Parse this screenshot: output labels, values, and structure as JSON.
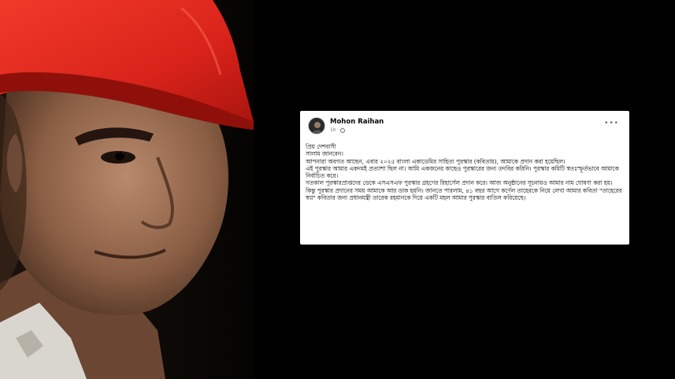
{
  "post": {
    "author": "Mohon Raihan",
    "time": "1h ·",
    "more": "•••",
    "lines": [
      "প্রিয় দেশবাসী",
      "সালাম জানবেন।",
      "আপনারা অবগত আছেন, এবার ২০২৫ বাংলা একাডেমির সাহিত্য পুরস্কার (কবিতায়), আমাকে প্রদান করা হয়েছিল।",
      "এই পুরস্কার আমার একদমই প্রত্যাশা ছিল না। আমি একজনের কাছেও পুরস্কারের জন্য তদবির করিনি। পুরস্কার কমিটি স্বতঃস্ফূর্তভাবে আমাকে নির্বাচিত করে।",
      "গতকাল পুরস্কারপ্রাপ্তদের ডেকে এসএসএফ পুরস্কার গ্রহণের রিহার্সেল প্রদান করে। আজ অনুষ্ঠানের সূচনায়ও আমার নাম ঘোষণা করা হয়।",
      "কিন্তু পুরস্কার প্রদানের সময় আমাকে আর ডাক হয়নি। জানতে পারলাম, ৪১ বছর আগে কর্ণেল তাহেরকে নিয়ে লেখা আমার কবিতা \"তাহেরের স্বপ্ন\" কবিতার জন্য প্রধানমন্ত্রী তারেক রহমানকে দিয়ে একটি মহল আমার পুরস্কার বাতিল করিয়েছে।"
    ]
  }
}
